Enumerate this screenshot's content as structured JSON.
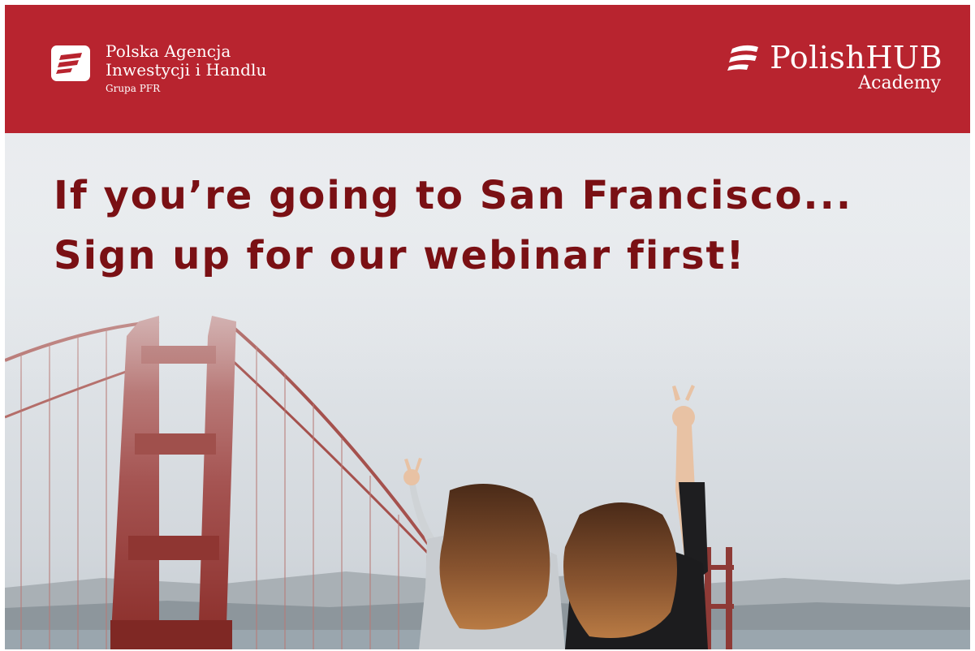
{
  "header": {
    "background_color": "#b8242f",
    "left_logo": {
      "icon": "paih-flag-icon",
      "line1": "Polska Agencja",
      "line2": "Inwestycji i Handlu",
      "line3": "Grupa PFR"
    },
    "right_logo": {
      "icon": "polishhub-stripes-icon",
      "title": "PolishHUB",
      "subtitle": "Academy"
    }
  },
  "banner": {
    "headline_line1": "If you’re going to San Francisco...",
    "headline_line2": "Sign up for our webinar first!",
    "headline_color": "#7a1014"
  },
  "photo": {
    "description_icon": "golden-gate-bridge-photo"
  }
}
